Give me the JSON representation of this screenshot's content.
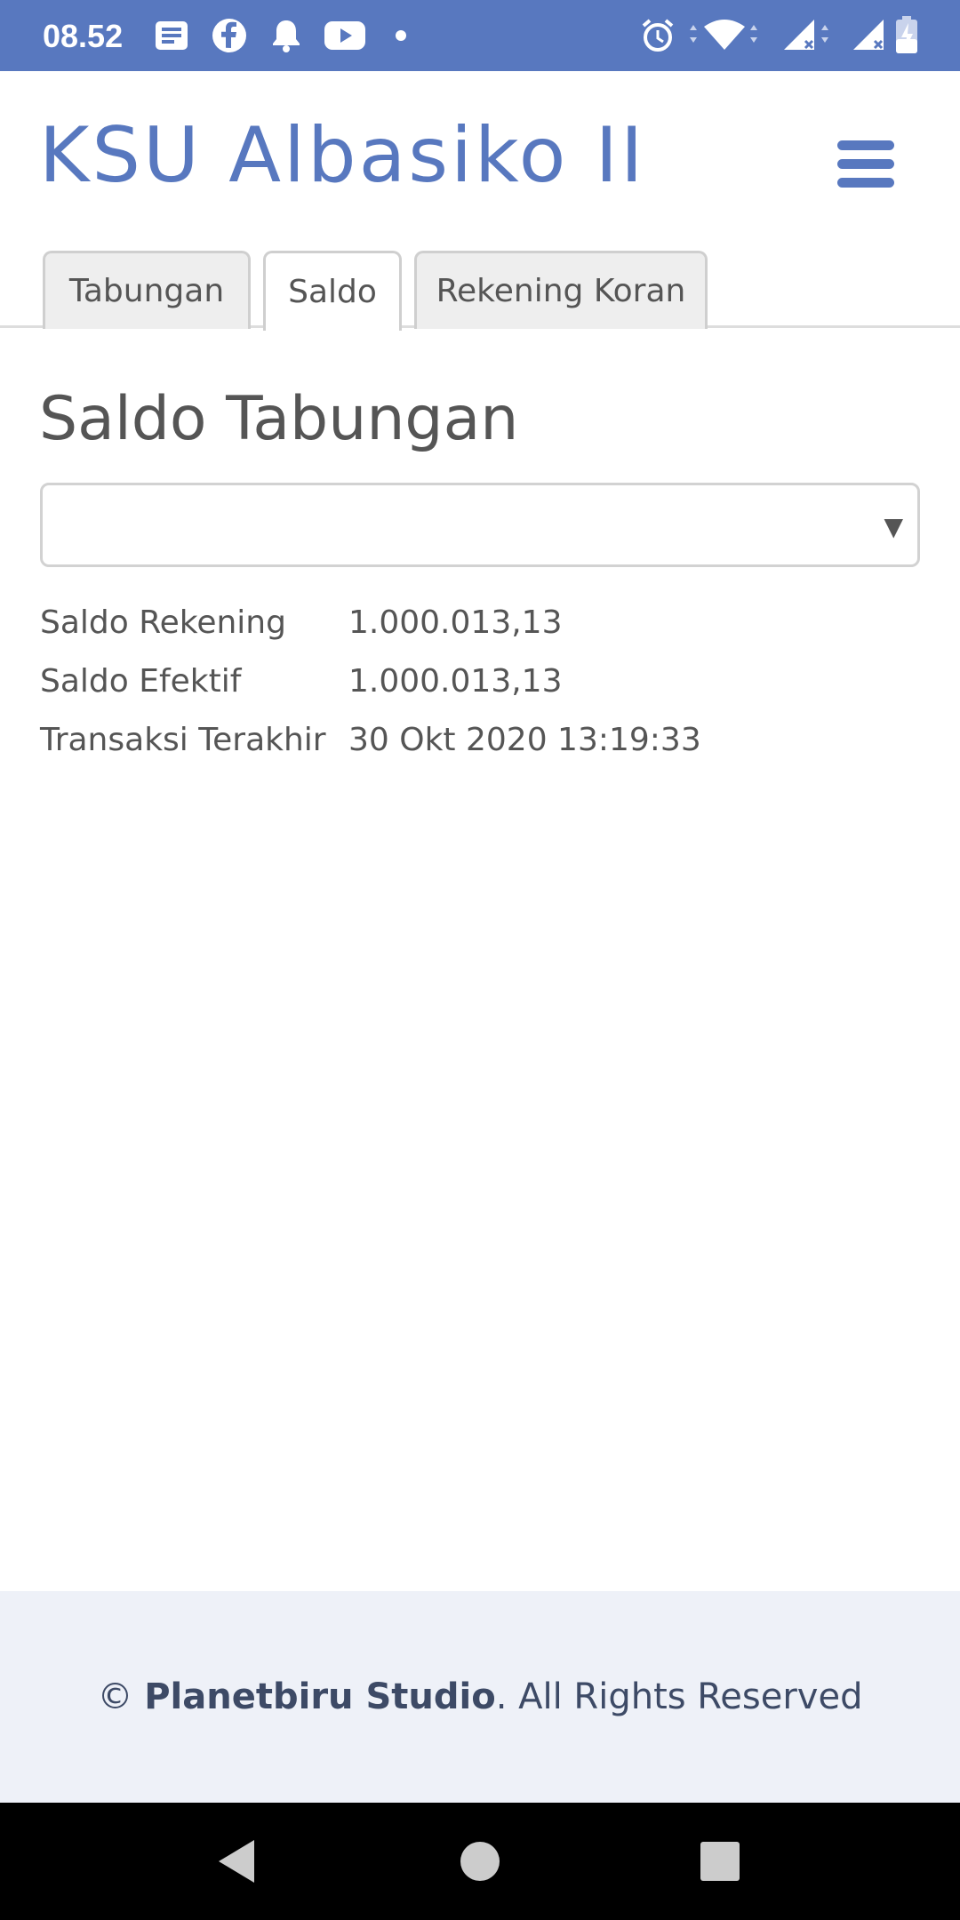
{
  "status_bar": {
    "time": "08.52",
    "left_icons": [
      "message-icon",
      "facebook-icon",
      "bell-icon",
      "youtube-icon",
      "dot-icon"
    ],
    "right_icons": [
      "alarm-icon",
      "wifi-icon",
      "signal-icon",
      "signal-icon",
      "battery-charging-icon"
    ],
    "color": "#5878bf"
  },
  "header": {
    "brand": "KSU Albasiko II",
    "menu_icon": "hamburger-menu-icon",
    "color": "#5878bf"
  },
  "tabs": [
    {
      "label": "Tabungan",
      "active": false
    },
    {
      "label": "Saldo",
      "active": true
    },
    {
      "label": "Rekening Koran",
      "active": false
    }
  ],
  "main": {
    "title": "Saldo Tabungan",
    "account_select": {
      "value": "",
      "arrow": "▼"
    },
    "details": [
      {
        "label": "Saldo Rekening",
        "value": "1.000.013,13"
      },
      {
        "label": "Saldo Efektif",
        "value": "1.000.013,13"
      },
      {
        "label": "Transaksi Terakhir",
        "value": "30 Okt 2020 13:19:33"
      }
    ]
  },
  "footer": {
    "copyright_symbol": "©",
    "company": "Planetbiru Studio",
    "suffix": ". All Rights Reserved"
  },
  "nav_bar": {
    "icons": [
      "back-icon",
      "home-icon",
      "recents-icon"
    ]
  }
}
